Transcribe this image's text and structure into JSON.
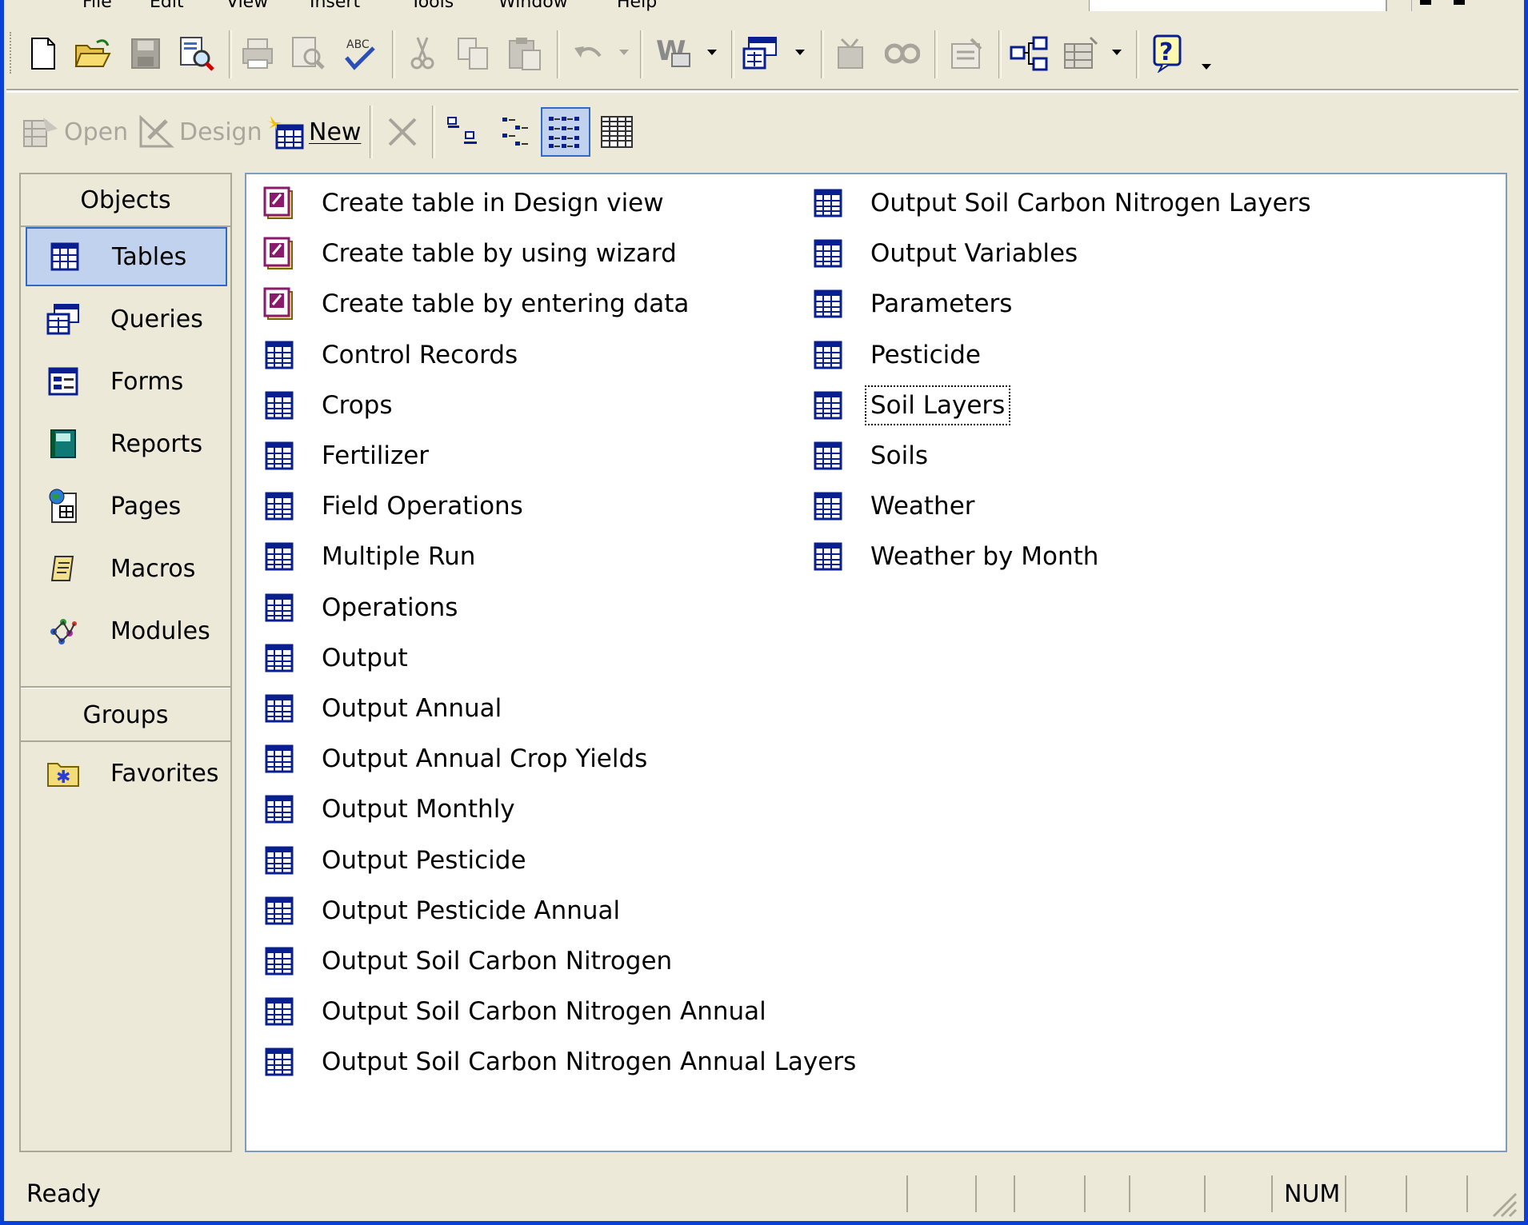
{
  "menu": {
    "items": [
      "File",
      "Edit",
      "View",
      "Insert",
      "Tools",
      "Window",
      "Help"
    ]
  },
  "toolbar": {
    "open_label": "Open",
    "design_label": "Design",
    "new_label": "New"
  },
  "objects_bar": {
    "header": "Objects",
    "items": [
      "Tables",
      "Queries",
      "Forms",
      "Reports",
      "Pages",
      "Macros",
      "Modules"
    ],
    "selected": "Tables",
    "groups_header": "Groups",
    "groups": [
      "Favorites"
    ]
  },
  "list": {
    "column1": [
      "Create table in Design view",
      "Create table by using wizard",
      "Create table by entering data",
      "Control Records",
      "Crops",
      "Fertilizer",
      "Field Operations",
      "Multiple Run",
      "Operations",
      "Output",
      "Output Annual",
      "Output Annual Crop Yields",
      "Output Monthly",
      "Output Pesticide",
      "Output Pesticide Annual",
      "Output Soil Carbon Nitrogen",
      "Output Soil Carbon Nitrogen Annual",
      "Output Soil Carbon Nitrogen Annual Layers"
    ],
    "column2": [
      "Output Soil Carbon Nitrogen Layers",
      "Output Variables",
      "Parameters",
      "Pesticide",
      "Soil Layers",
      "Soils",
      "Weather",
      "Weather by Month"
    ],
    "focused_item": "Soil Layers"
  },
  "status": {
    "text": "Ready",
    "num": "NUM"
  },
  "colors": {
    "face": "#ece9d8",
    "selection": "#c1d2ee",
    "selection_border": "#316ac5",
    "frame": "#0a3fd8",
    "table_icon": "#0a1f8f"
  }
}
